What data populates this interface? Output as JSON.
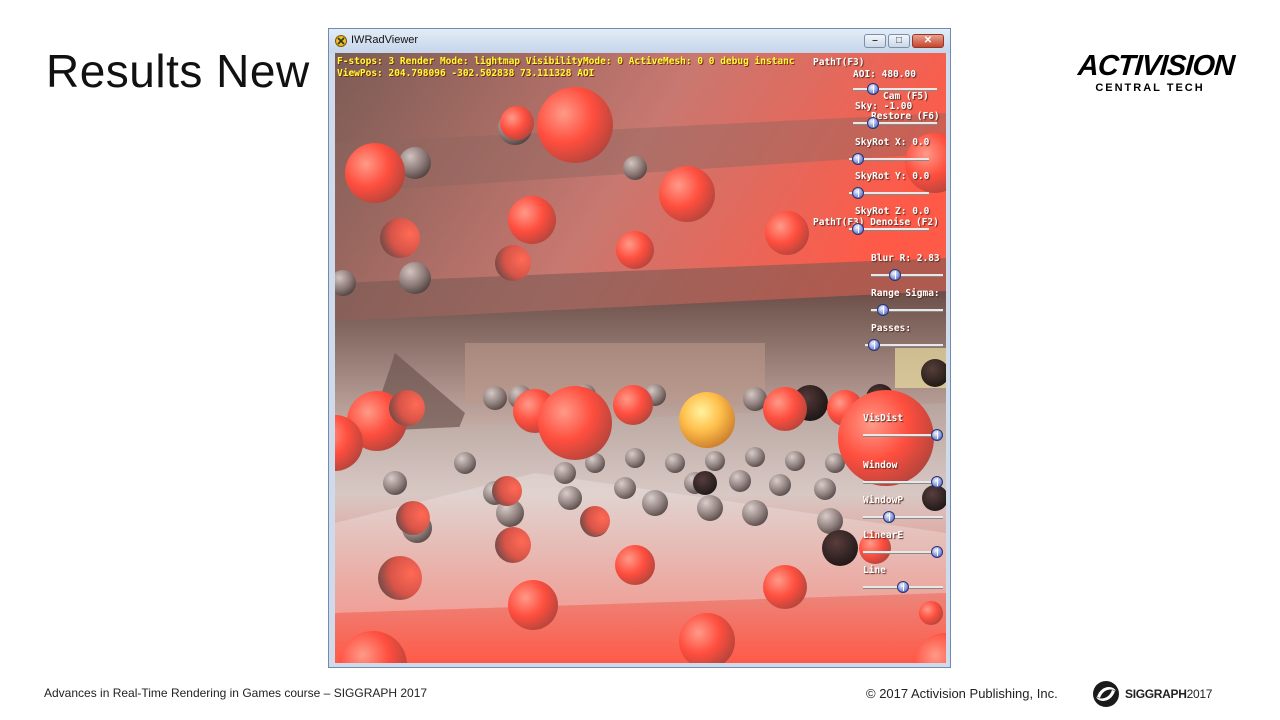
{
  "slide": {
    "title": "Results New",
    "footer_left": "Advances in Real-Time Rendering in Games course – SIGGRAPH 2017",
    "copyright": "© 2017 Activision Publishing, Inc.",
    "siggraph_bold": "SIGGRAPH",
    "siggraph_year": "2017"
  },
  "logo": {
    "line1": "ACTIVISION",
    "line2": "CENTRAL TECH"
  },
  "window": {
    "title": "IWRadViewer",
    "controls": {
      "minimize": "–",
      "maximize": "□",
      "close": "✕"
    }
  },
  "hud": {
    "line1": "F-stops: 3 Render Mode: lightmap VisibilityMode: 0 ActiveMesh: 0 0 debug instanc",
    "line2": "ViewPos: 204.798096 -302.502838 73.111328 AOI"
  },
  "panel": {
    "patht_f3": "PathT(F3)",
    "aoi": "AOI: 480.00",
    "cam": "Cam (F5)",
    "sky": "Sky: -1.00",
    "restore": "Restore (F6)",
    "skyrot_x": "SkyRot X: 0.0",
    "skyrot_y": "SkyRot Y: 0.0",
    "skyrot_z": "SkyRot Z: 0.0",
    "patht_denoise": "PathT(F3) Denoise (F2)",
    "blur_r": "Blur R: 2.83",
    "range_sigma": "Range Sigma:",
    "passes": "Passes:",
    "visdist": "VisDist",
    "window": "Window",
    "windowp": "WindowP",
    "lineare": "LinearE",
    "line": "Line"
  },
  "sliders": {
    "aoi": 0.2,
    "sky": 0.2,
    "skyrot_x": 0.05,
    "skyrot_y": 0.05,
    "skyrot_z": 0.05,
    "blur_r": 0.3,
    "range_sigma": 0.1,
    "passes": 0.05,
    "visdist": 1.0,
    "window": 1.0,
    "windowp": 0.3,
    "lineare": 1.0,
    "line": 0.5
  },
  "colors": {
    "hud_text": "#ffff33",
    "panel_text": "#ffffff",
    "sphere_red": "#ff5a4a"
  }
}
